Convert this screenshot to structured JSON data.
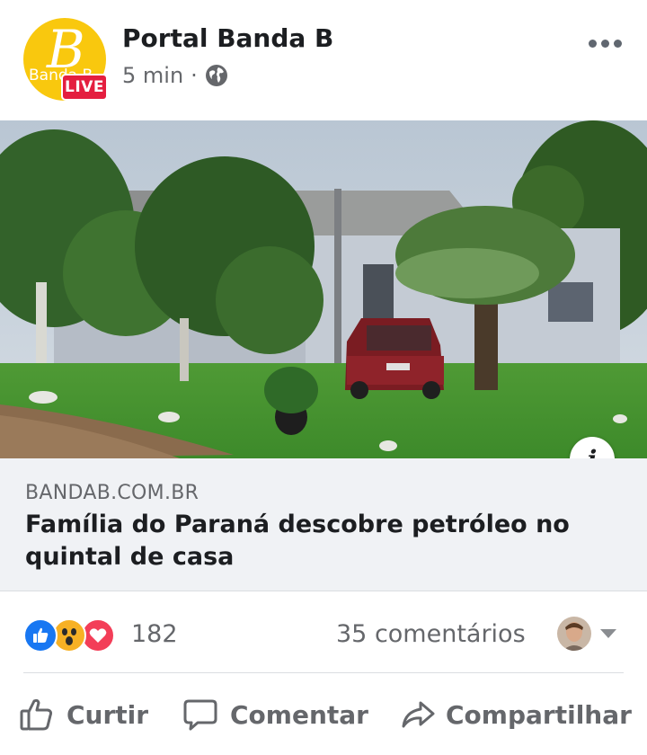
{
  "header": {
    "page_name": "Portal Banda B",
    "timestamp": "5 min",
    "separator": "·",
    "live_badge": "LIVE",
    "avatar_logo_letter": "B",
    "avatar_logo_word": "Banda B",
    "privacy_icon": "globe-icon",
    "more_icon": "ellipsis-icon"
  },
  "image": {
    "info_icon_glyph": "i"
  },
  "link_preview": {
    "domain": "BANDAB.COM.BR",
    "title": "Família do Paraná descobre petróleo no quintal de casa"
  },
  "reactions": {
    "icons": [
      "like-icon",
      "wow-icon",
      "love-icon"
    ],
    "count": "182",
    "comments": "35 comentários"
  },
  "actions": {
    "like_label": "Curtir",
    "comment_label": "Comentar",
    "share_label": "Compartilhar"
  },
  "colors": {
    "live_red": "#e41e3f",
    "avatar_yellow": "#f9c80e",
    "like_blue": "#1877f2",
    "wow_yellow": "#f7b125",
    "love_red": "#f33e58",
    "secondary_text": "#65676b",
    "preview_bg": "#f0f2f5"
  }
}
